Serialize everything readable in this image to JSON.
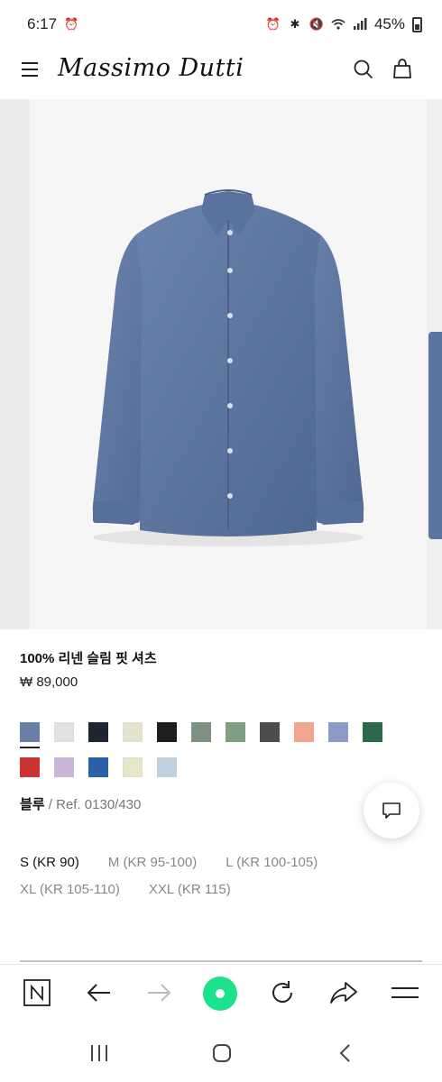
{
  "status_bar": {
    "time": "6:17",
    "battery": "45%"
  },
  "header": {
    "brand": "Massimo Dutti",
    "icons": [
      "menu-icon",
      "search-icon",
      "shopping-bag-icon"
    ]
  },
  "product": {
    "name": "100% 리넨 슬림 핏 셔츠",
    "price": "₩ 89,000",
    "image_alt_color": "#5d77a3",
    "color_name": "블루",
    "ref": " / Ref. 0130/430"
  },
  "swatches": {
    "row1": [
      "#6a7fa6",
      "#e1e0e2",
      "#1e2530",
      "#e3e3cd",
      "#1e1e1e",
      "#7e9183",
      "#7f9f80",
      "#4d4d4d",
      "#f0a68c",
      "#8a9ac9",
      "#2a6a4a"
    ],
    "row2": [
      "#cc3434",
      "#c9b5d6",
      "#2a62aa",
      "#e6e7c7",
      "#c0d0dc"
    ],
    "selected_index": 0
  },
  "sizes": {
    "row1": [
      {
        "label": "S (KR 90)",
        "available": true
      },
      {
        "label": "M (KR 95-100)",
        "available": false
      },
      {
        "label": "L (KR 100-105)",
        "available": false
      }
    ],
    "row2": [
      {
        "label": "XL (KR 105-110)",
        "available": false
      },
      {
        "label": "XXL (KR 115)",
        "available": false
      }
    ]
  },
  "browser_toolbar": {
    "icons": [
      "naver-icon",
      "back-arrow-icon",
      "forward-arrow-icon",
      "home-green-icon",
      "refresh-icon",
      "share-icon",
      "menu-lines-icon"
    ],
    "accent": "#1de28c"
  },
  "android_nav": {
    "icons": [
      "recent-apps-icon",
      "home-icon",
      "back-icon"
    ]
  }
}
